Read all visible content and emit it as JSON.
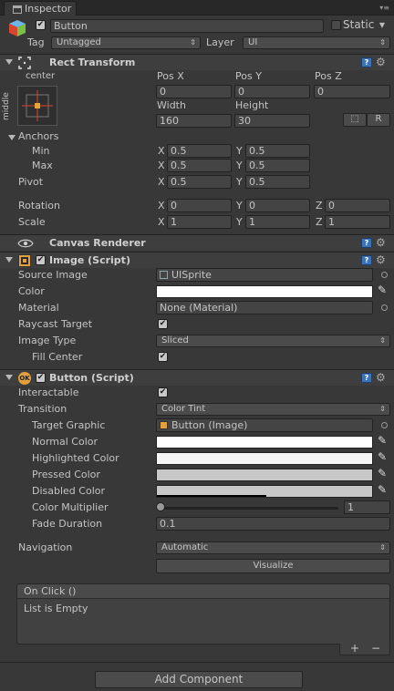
{
  "window": {
    "tab_label": "Inspector"
  },
  "go": {
    "name": "Button",
    "static_label": "Static",
    "tag_label": "Tag",
    "tag_value": "Untagged",
    "layer_label": "Layer",
    "layer_value": "UI"
  },
  "rect_transform": {
    "title": "Rect Transform",
    "anchor_preset_top": "center",
    "anchor_preset_side": "middle",
    "pos_x_label": "Pos X",
    "pos_y_label": "Pos Y",
    "pos_z_label": "Pos Z",
    "pos_x": "0",
    "pos_y": "0",
    "pos_z": "0",
    "width_label": "Width",
    "height_label": "Height",
    "width": "160",
    "height": "30",
    "r_button": "R",
    "anchors_label": "Anchors",
    "min_label": "Min",
    "max_label": "Max",
    "min_x": "0.5",
    "min_y": "0.5",
    "max_x": "0.5",
    "max_y": "0.5",
    "pivot_label": "Pivot",
    "pivot_x": "0.5",
    "pivot_y": "0.5",
    "rotation_label": "Rotation",
    "rot_x": "0",
    "rot_y": "0",
    "rot_z": "0",
    "scale_label": "Scale",
    "scale_x": "1",
    "scale_y": "1",
    "scale_z": "1",
    "x": "X",
    "y": "Y",
    "z": "Z"
  },
  "canvas_renderer": {
    "title": "Canvas Renderer"
  },
  "image": {
    "title": "Image (Script)",
    "source_image_label": "Source Image",
    "source_image": "UISprite",
    "color_label": "Color",
    "material_label": "Material",
    "material": "None (Material)",
    "raycast_label": "Raycast Target",
    "image_type_label": "Image Type",
    "image_type": "Sliced",
    "fill_center_label": "Fill Center"
  },
  "button": {
    "title": "Button (Script)",
    "interactable_label": "Interactable",
    "transition_label": "Transition",
    "transition": "Color Tint",
    "target_graphic_label": "Target Graphic",
    "target_graphic": "Button (Image)",
    "normal_color_label": "Normal Color",
    "highlighted_color_label": "Highlighted Color",
    "pressed_color_label": "Pressed Color",
    "disabled_color_label": "Disabled Color",
    "color_multiplier_label": "Color Multiplier",
    "color_multiplier": "1",
    "fade_duration_label": "Fade Duration",
    "fade_duration": "0.1",
    "navigation_label": "Navigation",
    "navigation": "Automatic",
    "visualize_label": "Visualize",
    "on_click_label": "On Click ()",
    "list_empty": "List is Empty",
    "plus": "+",
    "minus": "−"
  },
  "add_component_label": "Add Component",
  "colors": {
    "normal": "#ffffff",
    "highlighted": "#f5f5f5",
    "pressed": "#c8c8c8",
    "disabled": "#c8c8c8"
  },
  "color_multiplier_slider_level": 0
}
